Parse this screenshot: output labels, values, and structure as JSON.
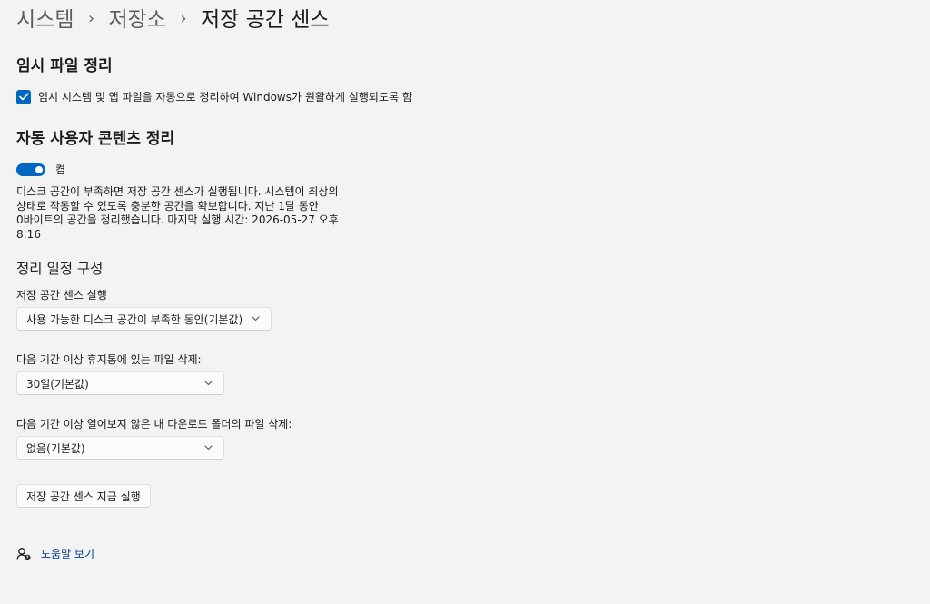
{
  "breadcrumb": {
    "items": [
      "시스템",
      "저장소"
    ],
    "current": "저장 공간 센스"
  },
  "temp_files": {
    "title": "임시 파일 정리",
    "checkbox_label": "임시 시스템 및 앱 파일을 자동으로 정리하여 Windows가 원활하게 실행되도록 함",
    "checked": true
  },
  "auto_cleanup": {
    "title": "자동 사용자 콘텐츠 정리",
    "toggle_state": "켬",
    "toggle_on": true,
    "description": "디스크 공간이 부족하면 저장 공간 센스가 실행됩니다. 시스템이 최상의 상태로 작동할 수 있도록 충분한 공간을 확보합니다. 지난 1달 동안 0바이트의 공간을 정리했습니다. 마지막 실행 시간: 2026-05-27 오후 8:16"
  },
  "schedule": {
    "title": "정리 일정 구성",
    "run_label": "저장 공간 센스 실행",
    "run_value": "사용 가능한 디스크 공간이 부족한 동안(기본값)",
    "recycle_label": "다음 기간 이상 휴지통에 있는 파일 삭제:",
    "recycle_value": "30일(기본값)",
    "downloads_label": "다음 기간 이상 열어보지 않은 내 다운로드 폴더의 파일 삭제:",
    "downloads_value": "없음(기본값)"
  },
  "run_now_button": "저장 공간 센스 지금 실행",
  "help": {
    "link": "도움말 보기",
    "icon": "help-person-icon"
  },
  "colors": {
    "accent": "#0067c0",
    "link": "#003e92",
    "background": "#f3f3f3"
  }
}
